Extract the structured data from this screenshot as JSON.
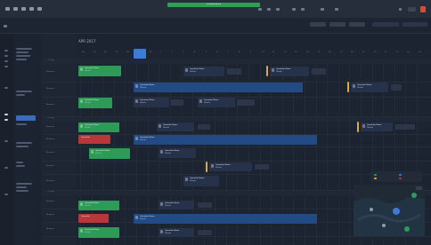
{
  "banner": {
    "text": "Schedule Board",
    "color": "#2f9e57"
  },
  "calendar": {
    "month_label": "APR 2017",
    "days": [
      "24",
      "25",
      "26",
      "27",
      "28",
      "29",
      "30",
      "1",
      "2",
      "3",
      "4",
      "5",
      "6",
      "7",
      "8",
      "9",
      "10",
      "11",
      "12",
      "13",
      "14",
      "15",
      "16",
      "17",
      "18",
      "19",
      "20",
      "21",
      "22",
      "23",
      "24"
    ],
    "today_index": 3
  },
  "groups": [
    {
      "label": "— Group"
    },
    {
      "label": "— Group"
    },
    {
      "label": "— Group"
    }
  ],
  "rows": [
    {
      "label": "Resource"
    },
    {
      "label": "Resource"
    },
    {
      "label": "Resource"
    },
    {
      "label": "Resource"
    },
    {
      "label": "Resource"
    },
    {
      "label": "Resource"
    },
    {
      "label": "Resource"
    },
    {
      "label": "Resource"
    },
    {
      "label": "Resource"
    },
    {
      "label": "Resource"
    },
    {
      "label": "Resource"
    },
    {
      "label": "Resource"
    }
  ],
  "events": [
    {
      "title": "Operation Name",
      "sub": "Details",
      "color": "green"
    },
    {
      "title": "Operation Name",
      "sub": "Details",
      "color": "dark"
    },
    {
      "title": "Operation Name",
      "sub": "Details",
      "color": "dark"
    },
    {
      "title": "Operation Name",
      "sub": "Details",
      "color": "blue"
    },
    {
      "title": "Operation Name",
      "sub": "Details",
      "color": "dark"
    },
    {
      "title": "Operation Name",
      "sub": "Details",
      "color": "green"
    },
    {
      "title": "Operation Name",
      "sub": "Details",
      "color": "dark"
    },
    {
      "title": "Operation Name",
      "sub": "Details",
      "color": "green"
    },
    {
      "title": "Operation Name",
      "sub": "Details",
      "color": "dark"
    },
    {
      "title": "Operation Name",
      "sub": "Details",
      "color": "dark"
    },
    {
      "title": "Operation",
      "sub": "",
      "color": "red"
    },
    {
      "title": "Operation Name",
      "sub": "Details",
      "color": "blue"
    },
    {
      "title": "Operation Name",
      "sub": "Details",
      "color": "green"
    },
    {
      "title": "Operation Name",
      "sub": "Details",
      "color": "dark"
    },
    {
      "title": "Operation Name",
      "sub": "Details",
      "color": "dark"
    },
    {
      "title": "Operation Name",
      "sub": "Details",
      "color": "dark"
    },
    {
      "title": "Operation Name",
      "sub": "Details",
      "color": "green"
    },
    {
      "title": "Operation Name",
      "sub": "Details",
      "color": "dark"
    },
    {
      "title": "Operation",
      "sub": "",
      "color": "red"
    },
    {
      "title": "Operation Name",
      "sub": "Details",
      "color": "blue"
    },
    {
      "title": "Operation Name",
      "sub": "Details",
      "color": "green"
    },
    {
      "title": "Operation Name",
      "sub": "Details",
      "color": "dark"
    }
  ],
  "legend": [
    {
      "label": "",
      "color": "#2d9b55"
    },
    {
      "label": "",
      "color": "#3b7bd9"
    },
    {
      "label": "",
      "color": "#e0a93b"
    },
    {
      "label": "",
      "color": "#b8383a"
    }
  ]
}
